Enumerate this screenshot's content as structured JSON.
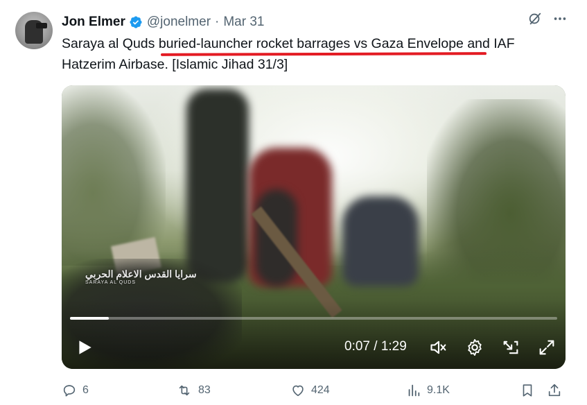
{
  "tweet": {
    "author_name": "Jon Elmer",
    "handle": "@jonelmer",
    "separator": "·",
    "date": "Mar 31",
    "text": "Saraya al Quds buried-launcher rocket barrages vs Gaza Envelope and IAF Hatzerim Airbase. [Islamic Jihad 31/3]"
  },
  "icons": {
    "verified": "verified-badge-icon",
    "grok": "grok-icon",
    "more": "more-icon"
  },
  "colors": {
    "verified_blue": "#1d9bf0",
    "underline_red": "#e31b23",
    "secondary_text": "#536471"
  },
  "video": {
    "current_time": "0:07",
    "separator": "/",
    "duration": "1:29",
    "time_display": "0:07 / 1:29",
    "progress": 0.08,
    "watermark_text": "سرايا القدس الاعلام الحربي",
    "watermark_sub": "SARAYA AL QUDS"
  },
  "actions": {
    "replies": "6",
    "reposts": "83",
    "likes": "424",
    "views": "9.1K"
  }
}
